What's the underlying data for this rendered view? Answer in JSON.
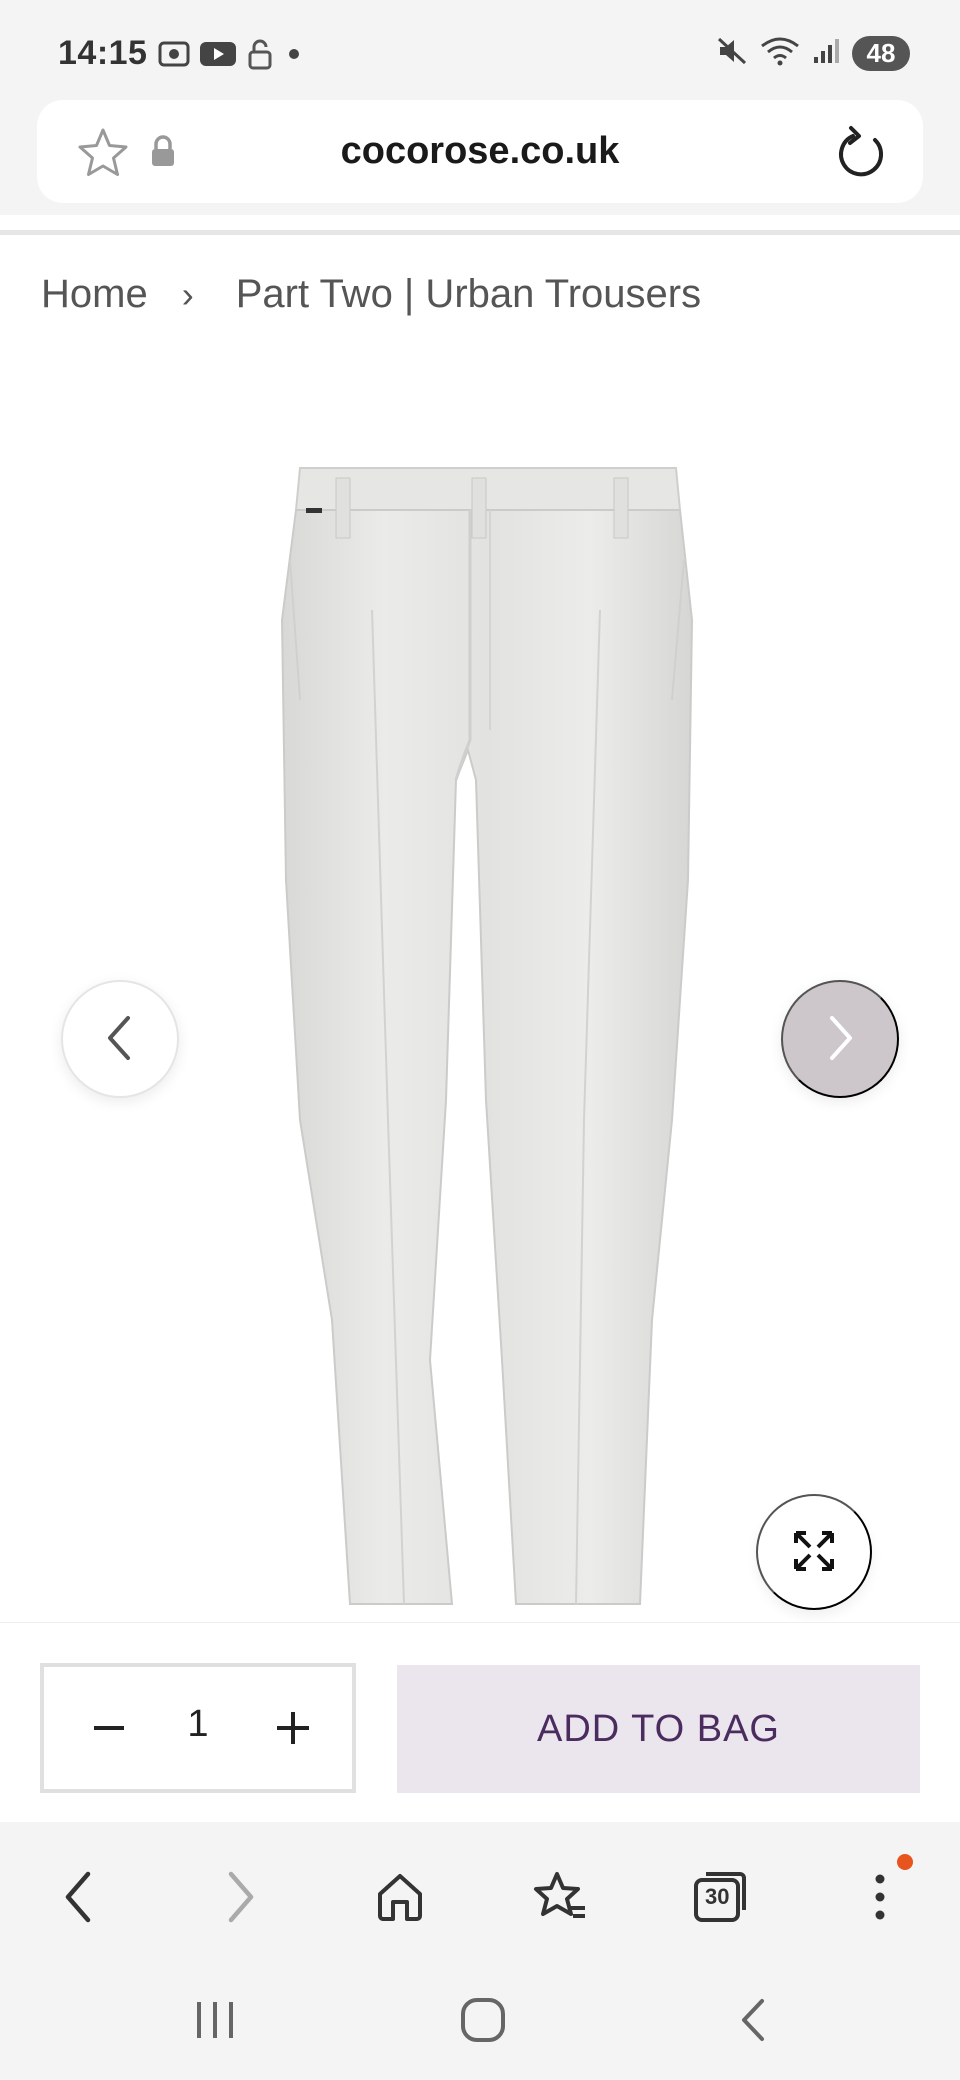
{
  "status_bar": {
    "time": "14:15",
    "battery": "48",
    "icons_left": [
      "screenshot-icon",
      "youtube-icon",
      "unlock-icon",
      "dot-icon"
    ],
    "icons_right": [
      "mute-icon",
      "wifi-icon",
      "signal-icon",
      "battery-icon"
    ]
  },
  "url_bar": {
    "url": "cocorose.co.uk",
    "icons": [
      "star-icon",
      "lock-icon",
      "reload-icon"
    ]
  },
  "breadcrumb": {
    "home": "Home",
    "separator": "›",
    "current": "Part Two | Urban Trousers"
  },
  "product": {
    "image_icon": "trousers-image",
    "prev_icon": "chevron-left-icon",
    "next_icon": "chevron-right-icon",
    "expand_icon": "expand-icon"
  },
  "cart": {
    "minus": "−",
    "quantity": "1",
    "plus": "+",
    "add_to_bag": "ADD TO BAG"
  },
  "browser_nav": {
    "tabs_count": "30",
    "icons": [
      "back-icon",
      "forward-icon",
      "home-icon",
      "bookmarks-icon",
      "tabs-icon",
      "menu-icon"
    ]
  },
  "system_nav": {
    "icons": [
      "recents-icon",
      "home-circle-icon",
      "back-icon"
    ]
  },
  "colors": {
    "accent_bg": "#ebe5ee",
    "accent_text": "#4a2c5e",
    "next_arrow_bg": "#cdc6cb",
    "notification": "#e8541e"
  }
}
